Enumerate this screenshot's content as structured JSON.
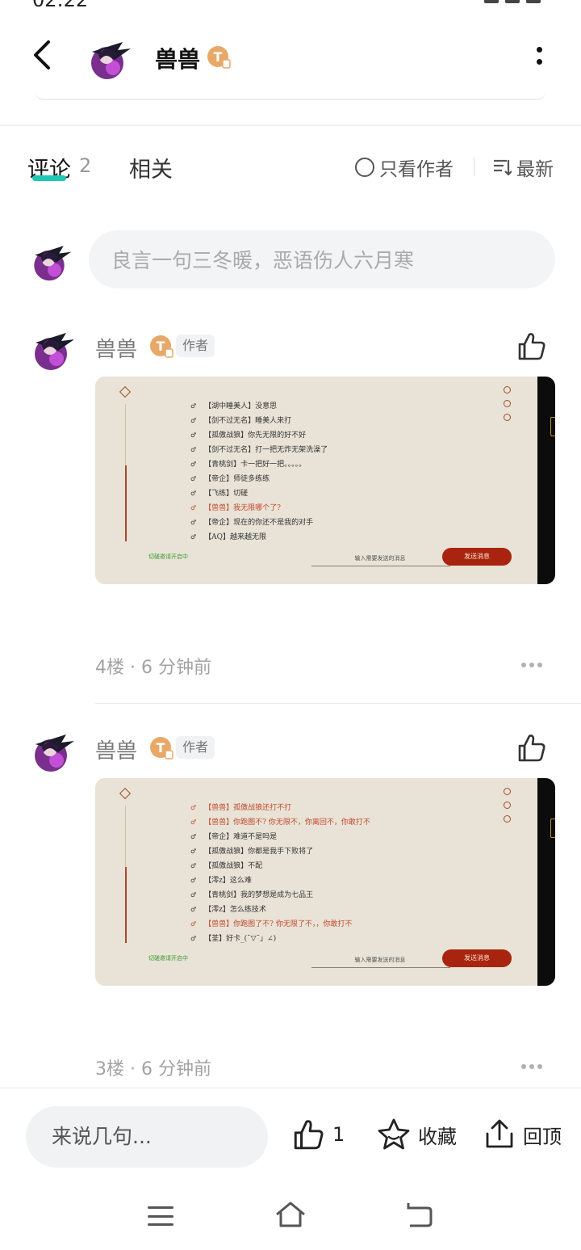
{
  "status_bar": {
    "time": "02:22"
  },
  "header": {
    "username": "兽兽",
    "badge_letter": "T"
  },
  "tabs": {
    "comment_label": "评论",
    "comment_count": "2",
    "related_label": "相关",
    "author_only_label": "只看作者",
    "sort_label": "最新"
  },
  "comment_input": {
    "placeholder": "良言一句三冬暖，恶语伤人六月寒"
  },
  "posts": [
    {
      "username": "兽兽",
      "badge_letter": "T",
      "author_tag": "作者",
      "floor": "4楼",
      "time": "6 分钟前",
      "screenshot": {
        "chat": [
          {
            "text": "【湖中睡美人】没意思",
            "highlight": false
          },
          {
            "text": "【剑不过无名】睡美人来打",
            "highlight": false
          },
          {
            "text": "【孤傲战狼】你先无限的好不好",
            "highlight": false
          },
          {
            "text": "【剑不过无名】打一把无炸无架洗澡了",
            "highlight": false
          },
          {
            "text": "【青桃剑】卡一把好一把。。。。。",
            "highlight": false
          },
          {
            "text": "【帝企】师徒多练练",
            "highlight": false
          },
          {
            "text": "【飞练】切磋",
            "highlight": false
          },
          {
            "text": "【兽兽】我无限哪个了?",
            "highlight": true
          },
          {
            "text": "【帝企】现在的你还不是我的对手",
            "highlight": false
          },
          {
            "text": "【AQ】越来越无限",
            "highlight": false
          }
        ],
        "status": "切磋邀请开启中",
        "input_placeholder": "输入需要发送的消息",
        "send_button": "发送消息"
      }
    },
    {
      "username": "兽兽",
      "badge_letter": "T",
      "author_tag": "作者",
      "floor": "3楼",
      "time": "6 分钟前",
      "screenshot": {
        "chat": [
          {
            "text": "【兽兽】孤傲战狼还打不打",
            "highlight": true
          },
          {
            "text": "【兽兽】你跑图不? 你无限不，你离回不，你敢打不",
            "highlight": true
          },
          {
            "text": "【帝企】难道不是吗是",
            "highlight": false
          },
          {
            "text": "【孤傲战狼】你都是我手下败将了",
            "highlight": false
          },
          {
            "text": "【孤傲战狼】不配",
            "highlight": false
          },
          {
            "text": "【澪z】这么难",
            "highlight": false
          },
          {
            "text": "【青桃剑】我的梦想是成为七品王",
            "highlight": false
          },
          {
            "text": "【澪z】怎么练技术",
            "highlight": false
          },
          {
            "text": "【兽兽】你跑图了不? 你无限了不，，你敢打不",
            "highlight": true
          },
          {
            "text": "【荃】好卡_(ˉ▽ˉ」∠)",
            "highlight": false
          }
        ],
        "status": "切磋邀请开启中",
        "input_placeholder": "输入需要发送的消息",
        "send_button": "发送消息"
      }
    }
  ],
  "bottom_bar": {
    "say_placeholder": "来说几句...",
    "like_count": "1",
    "favorite_label": "收藏",
    "top_label": "回顶"
  },
  "colors": {
    "accent": "#1ec8b4",
    "badge": "#e8a868",
    "send_button": "#a8240e"
  }
}
